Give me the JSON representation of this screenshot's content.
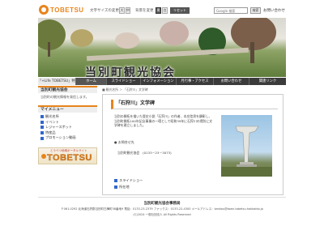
{
  "header": {
    "logo_text": "TOBETSU",
    "font_size_label": "文字サイズの変更",
    "font_size_buttons": [
      "大",
      "中",
      "小"
    ],
    "bg_color_label": "背景を変更",
    "bg_color_buttons": [
      "黒",
      "白"
    ],
    "reset_label": "リセット",
    "search_placeholder": "Google 検索",
    "search_button": "検索",
    "inquiry_label": "お問い合わせ"
  },
  "banner": {
    "title": "当別町観光協会"
  },
  "nav": {
    "items": [
      {
        "label": "「+Life TOBETSU」特設ページ"
      },
      {
        "label": "ホーム"
      },
      {
        "label": "スライドショー"
      },
      {
        "label": "インフォメーション"
      },
      {
        "label": "月行事・アクセス"
      },
      {
        "label": "お問い合わせ"
      },
      {
        "label": "関連リンク"
      }
    ]
  },
  "sidebar": {
    "section_title": "当別町観光協会",
    "section_text": "当別町の観光情報を発信します。",
    "menu_title": "マイメニュー",
    "menu_items": [
      {
        "label": "観光名所"
      },
      {
        "label": "イベント"
      },
      {
        "label": "レジャースポット"
      },
      {
        "label": "特産品"
      },
      {
        "label": "プロモーション動画"
      }
    ],
    "banner_small": "とうべつ地域ポータルサイト",
    "banner_big": "TOBETSU"
  },
  "breadcrumb": "■ 観光名所 ＞ 「石狩川」文学碑",
  "content": {
    "title": "「石狩川」文学碑",
    "body": "当別の開拓を描いた歴史小説「石狩川」の作者、本庄陸男を顕彰し、当別町開拓100年記念事業の一環として昭和39年に石狩川の堤防に文学碑を建立しました。",
    "contact_head": "● お問合せ先",
    "contact_line": "当別町観光協会　(0133－23－3073)",
    "links": [
      {
        "label": "スライドショー"
      },
      {
        "label": "所在地"
      }
    ]
  },
  "footer": {
    "org": "当別町観光協会事務局",
    "address": "〒061-0292 北海道石狩郡当別町白樺町58番地9 電話：0133-23-2379 ファックス：0133-22-4300 メールアドレス：kankou@town.tobetsu.hokkaido.jp",
    "copyright": "(C)2024 一般社団法人 All Rights Reserved"
  }
}
